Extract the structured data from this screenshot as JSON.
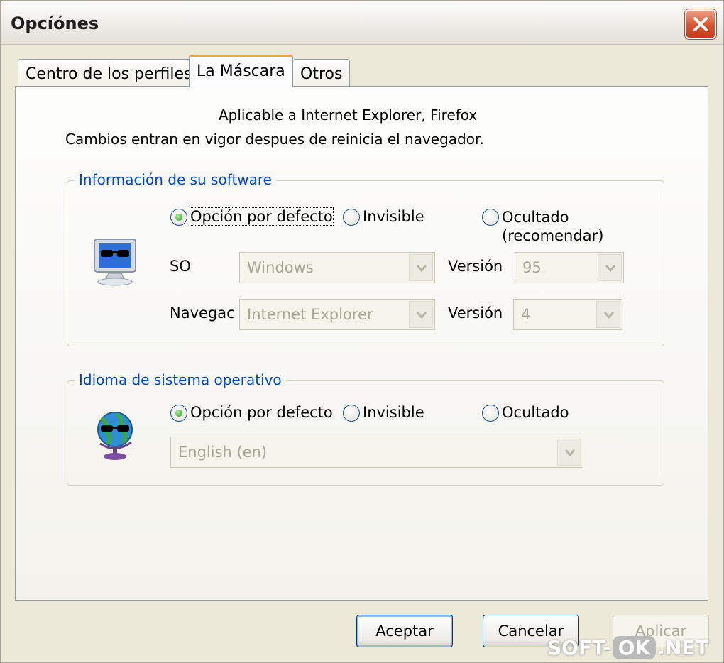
{
  "window": {
    "title": "Opcíónes"
  },
  "tabs": [
    {
      "label": "Centro de los perfiles"
    },
    {
      "label": "La Máscara"
    },
    {
      "label": "Otros"
    }
  ],
  "info": {
    "line1": "Aplicable a Internet Explorer, Firefox",
    "line2": "Cambios entran en vigor despues de reinicia el navegador."
  },
  "software_group": {
    "legend": "Información de su software",
    "radios": [
      {
        "label": "Opción por defecto",
        "checked": true
      },
      {
        "label": "Invisible",
        "checked": false
      },
      {
        "label": "Ocultado\n(recomendar)",
        "checked": false
      }
    ],
    "os_label": "SO",
    "os_value": "Windows",
    "os_version_label": "Versión",
    "os_version_value": "95",
    "browser_label": "Navegac",
    "browser_value": "Internet Explorer",
    "browser_version_label": "Versión",
    "browser_version_value": "4",
    "icon": "monitor-with-sunglasses-icon"
  },
  "language_group": {
    "legend": "Idioma de sistema operativo",
    "radios": [
      {
        "label": "Opción por defecto",
        "checked": true
      },
      {
        "label": "Invisible",
        "checked": false
      },
      {
        "label": "Ocultado",
        "checked": false
      }
    ],
    "language_value": "English (en)",
    "icon": "globe-with-sunglasses-icon"
  },
  "buttons": {
    "accept": "Aceptar",
    "cancel": "Cancelar",
    "apply": "Aplicar"
  },
  "watermark": {
    "left": "SOFT-",
    "middle": "OK",
    "right": ".NET"
  },
  "colors": {
    "legend_text": "#0046d5",
    "active_tab_accent": "#f5a623",
    "close_button": "#d9542e"
  }
}
